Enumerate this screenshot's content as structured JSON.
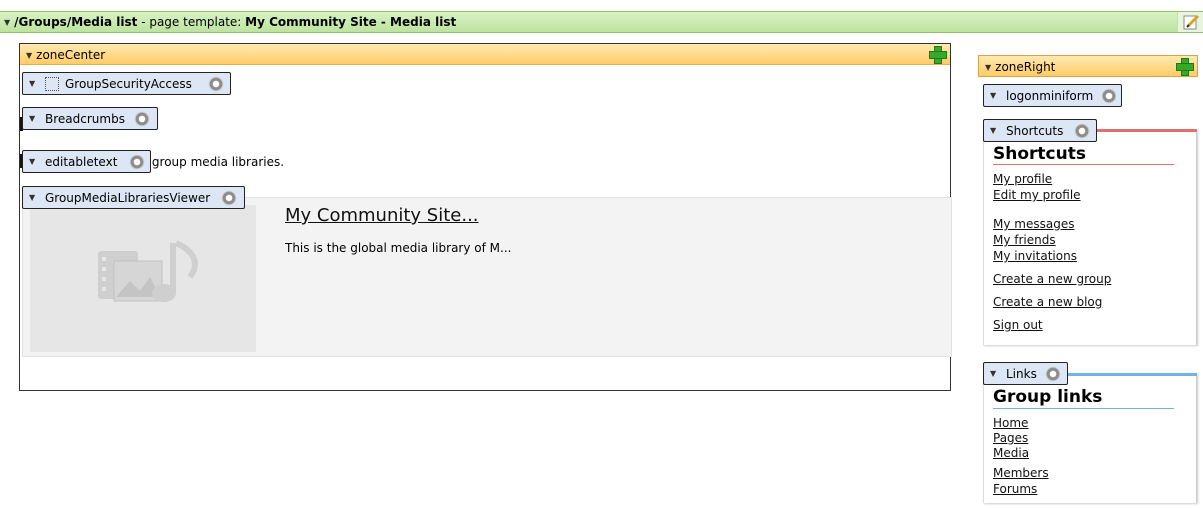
{
  "top_bar": {
    "path": "/Groups/Media list",
    "prefix": " - page template: ",
    "template_name": "My Community Site - Media list"
  },
  "zone_center": {
    "label": "zoneCenter",
    "webparts": [
      {
        "label": "GroupSecurityAccess"
      },
      {
        "label": "Breadcrumbs"
      },
      {
        "label": "editabletext"
      },
      {
        "label": "GroupMediaLibrariesViewer"
      }
    ],
    "editable_text_visible": "t of group media libraries.",
    "media": {
      "title": "My Community Site...",
      "description": "This is the global media library of M..."
    }
  },
  "zone_right": {
    "label": "zoneRight",
    "webparts": [
      {
        "label": "logonminiform"
      },
      {
        "label": "Shortcuts"
      },
      {
        "label": "Links"
      }
    ],
    "shortcuts": {
      "title": "Shortcuts",
      "links": [
        "My profile",
        "Edit my profile",
        "My messages",
        "My friends",
        "My invitations",
        "Create a new group",
        "Create a new blog",
        "Sign out"
      ]
    },
    "group_links": {
      "title": "Group links",
      "links": [
        "Home",
        "Pages",
        "Media",
        "Members",
        "Forums"
      ]
    }
  },
  "colors": {
    "template_bar": "#bde3a0",
    "zone_header": "#ffcc66",
    "webpart_chip": "#dce6f4",
    "shortcuts_accent": "#e27070",
    "links_accent": "#73b2e6"
  }
}
